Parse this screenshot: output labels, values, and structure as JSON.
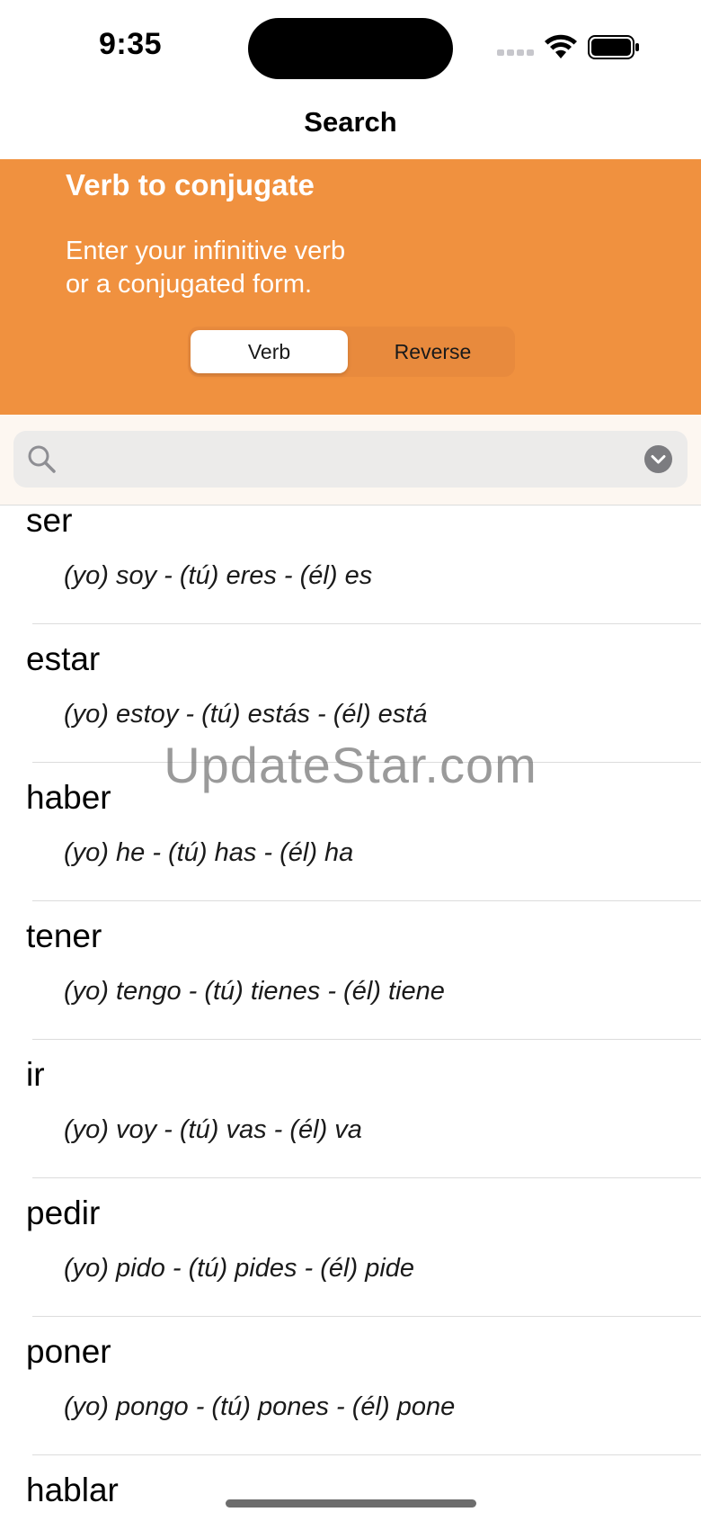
{
  "status_bar": {
    "time": "9:35"
  },
  "nav": {
    "title": "Search"
  },
  "header": {
    "title": "Verb to conjugate",
    "subtitle_line1": "Enter your infinitive verb",
    "subtitle_line2": "or a conjugated form.",
    "segments": [
      {
        "label": "Verb",
        "selected": true
      },
      {
        "label": "Reverse",
        "selected": false
      }
    ],
    "accent_color": "#f0913f"
  },
  "search": {
    "value": "",
    "placeholder": ""
  },
  "verbs": [
    {
      "infinitive": "ser",
      "forms": "(yo) soy - (tú) eres - (él) es"
    },
    {
      "infinitive": "estar",
      "forms": "(yo) estoy - (tú) estás - (él) está"
    },
    {
      "infinitive": "haber",
      "forms": "(yo) he - (tú) has - (él) ha"
    },
    {
      "infinitive": "tener",
      "forms": "(yo) tengo - (tú) tienes - (él) tiene"
    },
    {
      "infinitive": "ir",
      "forms": "(yo) voy - (tú) vas - (él) va"
    },
    {
      "infinitive": "pedir",
      "forms": "(yo) pido - (tú) pides - (él) pide"
    },
    {
      "infinitive": "poner",
      "forms": "(yo) pongo - (tú) pones - (él) pone"
    },
    {
      "infinitive": "hablar",
      "forms": ""
    }
  ],
  "watermark": "UpdateStar.com"
}
